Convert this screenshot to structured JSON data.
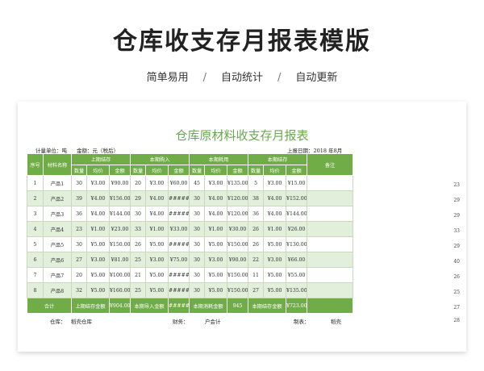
{
  "hero": {
    "title": "仓库收支存月报表模版"
  },
  "tags": [
    "简单易用",
    "自动统计",
    "自动更新"
  ],
  "separator": "/",
  "doc": {
    "title": "仓库原材料收支存月报表",
    "unit_label": "计量单位：吨",
    "amount_label": "金额：元（税后）",
    "report_date": "上报日期：2018 年8月"
  },
  "table": {
    "headers": {
      "index": "序号",
      "name": "材料名称",
      "prev": "上期结存",
      "in": "本期购入",
      "out": "本期耗用",
      "bal": "本期结存",
      "remark": "备注",
      "qty": "数量",
      "price": "均价",
      "amount": "金额"
    },
    "rows": [
      [
        "1",
        "产品1",
        "30",
        "¥3.00",
        "¥90.00",
        "20",
        "¥3.00",
        "¥60.00",
        "45",
        "¥3.00",
        "¥135.00",
        "5",
        "¥3.00",
        "¥15.00",
        ""
      ],
      [
        "2",
        "产品2",
        "39",
        "¥4.00",
        "¥156.00",
        "29",
        "¥4.00",
        "########",
        "30",
        "¥4.00",
        "¥120.00",
        "38",
        "¥4.00",
        "¥152.00",
        ""
      ],
      [
        "3",
        "产品3",
        "36",
        "¥4.00",
        "¥144.00",
        "30",
        "¥4.00",
        "########",
        "30",
        "¥4.00",
        "¥120.00",
        "36",
        "¥4.00",
        "¥144.00",
        ""
      ],
      [
        "4",
        "产品4",
        "23",
        "¥1.00",
        "¥23.00",
        "33",
        "¥1.00",
        "¥33.00",
        "30",
        "¥1.00",
        "¥30.00",
        "26",
        "¥1.00",
        "¥26.00",
        ""
      ],
      [
        "5",
        "产品5",
        "30",
        "¥5.00",
        "¥150.00",
        "26",
        "¥5.00",
        "########",
        "30",
        "¥5.00",
        "¥150.00",
        "26",
        "¥5.00",
        "¥130.00",
        ""
      ],
      [
        "6",
        "产品6",
        "27",
        "¥3.00",
        "¥81.00",
        "25",
        "¥3.00",
        "¥75.00",
        "30",
        "¥3.00",
        "¥90.00",
        "22",
        "¥3.00",
        "¥66.00",
        ""
      ],
      [
        "7",
        "产品7",
        "20",
        "¥5.00",
        "¥100.00",
        "21",
        "¥5.00",
        "########",
        "30",
        "¥5.00",
        "¥150.00",
        "11",
        "¥5.00",
        "¥55.00",
        ""
      ],
      [
        "8",
        "产品8",
        "32",
        "¥5.00",
        "¥160.00",
        "25",
        "¥5.00",
        "########",
        "30",
        "¥5.00",
        "¥150.00",
        "27",
        "¥5.00",
        "¥135.00",
        ""
      ]
    ],
    "total": {
      "label": "合计",
      "prev_label": "上期结存金额",
      "prev_value": "¥904.00",
      "in_label": "本期导入金额",
      "in_value": "########",
      "out_label": "本期消耗金额",
      "out_value": "945",
      "bal_label": "本期结存金额",
      "bal_value": "¥723.00"
    }
  },
  "row_numbers": [
    "23",
    "29",
    "29",
    "33",
    "29",
    "40",
    "26",
    "25",
    "27",
    "28"
  ],
  "footer": {
    "warehouse_label": "仓库：",
    "warehouse_value": "稻壳仓库",
    "finance_label": "财务：",
    "finance_value": "户会计",
    "maker_label": "制表：",
    "maker_value": "稻壳"
  }
}
